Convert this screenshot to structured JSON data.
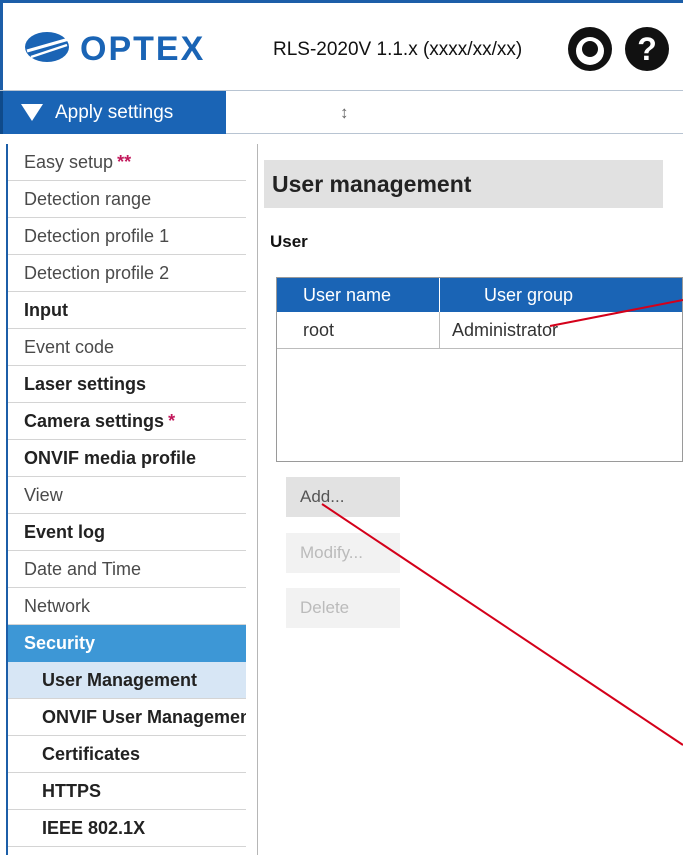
{
  "header": {
    "logo_text": "OPTEX",
    "version": "RLS-2020V 1.1.x (xxxx/xx/xx)",
    "user_icon": "user-icon",
    "help_icon": "help-icon"
  },
  "toolbar": {
    "apply_label": "Apply settings",
    "resize_glyph": "↕"
  },
  "sidebar": {
    "items": [
      {
        "label": "Easy setup",
        "star": "**"
      },
      {
        "label": "Detection range"
      },
      {
        "label": "Detection profile 1"
      },
      {
        "label": "Detection profile 2"
      },
      {
        "label": "Input"
      },
      {
        "label": "Event code"
      },
      {
        "label": "Laser settings"
      },
      {
        "label": "Camera settings",
        "star": "*"
      },
      {
        "label": "ONVIF media profile"
      },
      {
        "label": "View"
      },
      {
        "label": "Event log"
      },
      {
        "label": "Date and Time"
      },
      {
        "label": "Network"
      },
      {
        "label": "Security"
      },
      {
        "label": "User Management"
      },
      {
        "label": "ONVIF User Management"
      },
      {
        "label": "Certificates"
      },
      {
        "label": "HTTPS"
      },
      {
        "label": "IEEE 802.1X"
      }
    ]
  },
  "main": {
    "title": "User management",
    "section": "User",
    "table": {
      "headers": [
        "User name",
        "User group"
      ],
      "rows": [
        [
          "root",
          "Administrator"
        ]
      ]
    },
    "buttons": {
      "add": "Add...",
      "modify": "Modify...",
      "delete": "Delete"
    }
  },
  "colors": {
    "brand_blue": "#1a64b5",
    "active_nav": "#3d97d6",
    "annotation": "#d4001a"
  }
}
